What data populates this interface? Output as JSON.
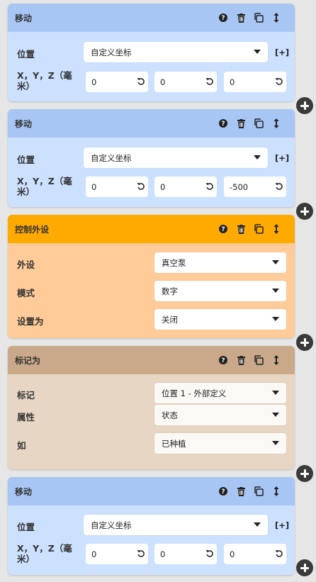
{
  "colors": {
    "move_header": "#a8c6f4",
    "move_body": "#cce0ff",
    "control_header": "#ffaa00",
    "control_body": "#ffcc99",
    "mark_header": "#c9a989",
    "mark_body": "#e8d6c4",
    "fab": "#3a3a3a"
  },
  "icons": {
    "help": "help-circle-icon",
    "delete": "trash-icon",
    "duplicate": "copy-icon",
    "drag": "drag-vertical-icon",
    "reset": "undo-icon",
    "add": "plus-circle-icon"
  },
  "steps": [
    {
      "title": "移动",
      "position_label": "位置",
      "position_value": "自定义坐标",
      "expand": "[+]",
      "xyz_label": "X，Y，Z（毫米）",
      "x": "0",
      "y": "0",
      "z": "0"
    },
    {
      "title": "移动",
      "position_label": "位置",
      "position_value": "自定义坐标",
      "expand": "[+]",
      "xyz_label": "X，Y，Z（毫米）",
      "x": "0",
      "y": "0",
      "z": "-500"
    },
    {
      "title": "控制外设",
      "fields": [
        {
          "label": "外设",
          "value": "真空泵"
        },
        {
          "label": "模式",
          "value": "数字"
        },
        {
          "label": "设置为",
          "value": "关闭"
        }
      ]
    },
    {
      "title": "标记为",
      "fields": [
        {
          "label": "标记",
          "value": "位置 1 - 外部定义"
        },
        {
          "label": "属性",
          "value": "状态"
        },
        {
          "label": "如",
          "value": "已种植"
        }
      ]
    },
    {
      "title": "移动",
      "position_label": "位置",
      "position_value": "自定义坐标",
      "expand": "[+]",
      "xyz_label": "X，Y，Z（毫米）",
      "x": "0",
      "y": "0",
      "z": "0"
    }
  ]
}
